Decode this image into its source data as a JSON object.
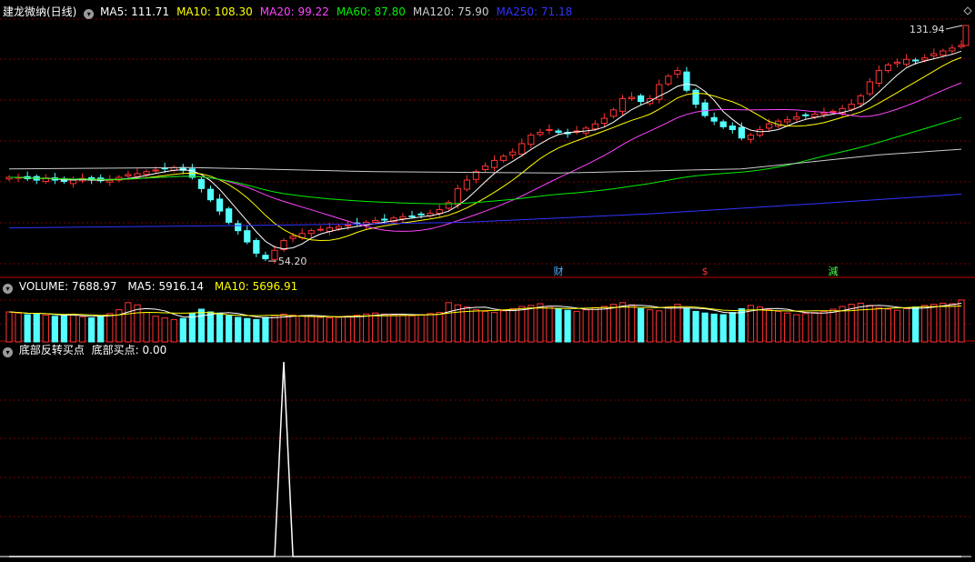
{
  "stock": {
    "title": "建龙微纳(日线)",
    "ma": [
      {
        "label": "MA5: 111.71",
        "color": "#ffffff"
      },
      {
        "label": "MA10: 108.30",
        "color": "#ffff00"
      },
      {
        "label": "MA20: 99.22",
        "color": "#ff44ff"
      },
      {
        "label": "MA60: 87.80",
        "color": "#00ee00"
      },
      {
        "label": "MA120: 75.90",
        "color": "#cccccc"
      },
      {
        "label": "MA250: 71.18",
        "color": "#3333ff"
      }
    ],
    "high_label": "131.94",
    "low_label": "54.20",
    "event_markers": [
      "财",
      "$",
      "減"
    ]
  },
  "volume": {
    "title": "VOLUME: 7688.97",
    "ma5": "MA5: 5916.14",
    "ma10": "MA10: 5696.91"
  },
  "indicator": {
    "title": "底部反转买点",
    "value": "底部买点: 0.00"
  },
  "colors": {
    "up": "#ff3333",
    "down": "#54ffff",
    "grid": "#7a0000",
    "ma5": "#ffffff",
    "ma10": "#ffff00",
    "ma20": "#ff44ff",
    "ma60": "#00ee00",
    "ma120": "#cccccc",
    "ma250": "#3333ff"
  },
  "chart_data": {
    "type": "candlestick",
    "series": [
      {
        "name": "K",
        "closes": [
          84,
          84,
          83.5,
          83,
          83.8,
          83,
          82.5,
          83,
          83.6,
          83,
          82.8,
          83,
          84,
          85,
          85.3,
          86,
          86.6,
          87,
          87.5,
          86.5,
          84,
          80,
          76,
          72,
          68,
          65,
          61,
          57,
          55,
          58,
          61.5,
          63,
          64,
          65,
          65.5,
          66,
          66.5,
          67,
          67.5,
          68,
          68.6,
          69,
          69.5,
          70,
          70.2,
          70.8,
          71.2,
          72.5,
          75,
          80,
          83,
          86,
          88,
          90,
          91.5,
          93,
          96,
          99,
          100,
          101,
          100,
          99.5,
          100.5,
          101.5,
          103,
          105,
          108,
          112,
          112.5,
          111,
          112,
          117,
          120,
          122,
          115,
          110,
          106,
          104,
          102,
          101,
          98,
          99,
          101,
          103,
          104,
          104.5,
          105.5,
          106,
          106.5,
          107,
          107.5,
          108.5,
          110,
          113,
          118,
          122,
          124,
          125,
          126,
          125.5,
          126.5,
          128,
          129,
          130,
          131
        ]
      }
    ],
    "volume_series": [
      {
        "name": "VOLUME",
        "values": [
          5500,
          5300,
          5000,
          5200,
          4900,
          4700,
          4800,
          5100,
          4600,
          4400,
          4700,
          5200,
          5900,
          7200,
          6800,
          5400,
          4700,
          4400,
          4100,
          4300,
          5200,
          6000,
          5500,
          5300,
          4800,
          4500,
          4300,
          4100,
          4500,
          4800,
          5100,
          4900,
          4800,
          4700,
          4500,
          4400,
          4500,
          4700,
          4900,
          5100,
          5300,
          5100,
          5000,
          4900,
          4800,
          5000,
          5200,
          5400,
          7200,
          6800,
          6400,
          5900,
          5600,
          5400,
          5700,
          6100,
          6500,
          6700,
          7000,
          6500,
          6100,
          5800,
          5600,
          5900,
          6300,
          6500,
          6900,
          7200,
          6800,
          6100,
          5900,
          5700,
          6400,
          6900,
          6200,
          5600,
          5300,
          5100,
          5000,
          5400,
          6100,
          6700,
          6400,
          5900,
          5600,
          5300,
          5000,
          5200,
          5400,
          5600,
          6000,
          6500,
          6900,
          7100,
          6700,
          6300,
          6000,
          5800,
          6100,
          6400,
          6700,
          6900,
          7100,
          7000,
          7688.97
        ]
      }
    ],
    "indicator_series": [
      {
        "name": "底部买点",
        "values": [
          0,
          0,
          0,
          0,
          0,
          0,
          0,
          0,
          0,
          0,
          0,
          0,
          0,
          0,
          0,
          0,
          0,
          0,
          0,
          0,
          0,
          0,
          0,
          0,
          0,
          0,
          0,
          0,
          0,
          0,
          1,
          0,
          0,
          0,
          0,
          0,
          0,
          0,
          0,
          0,
          0,
          0,
          0,
          0,
          0,
          0,
          0,
          0,
          0,
          0,
          0,
          0,
          0,
          0,
          0,
          0,
          0,
          0,
          0,
          0,
          0,
          0,
          0,
          0,
          0,
          0,
          0,
          0,
          0,
          0,
          0,
          0,
          0,
          0,
          0,
          0,
          0,
          0,
          0,
          0,
          0,
          0,
          0,
          0,
          0,
          0,
          0,
          0,
          0,
          0,
          0,
          0,
          0,
          0,
          0,
          0,
          0,
          0,
          0,
          0,
          0,
          0,
          0,
          0,
          0
        ]
      }
    ],
    "price_range": [
      50,
      140
    ]
  }
}
